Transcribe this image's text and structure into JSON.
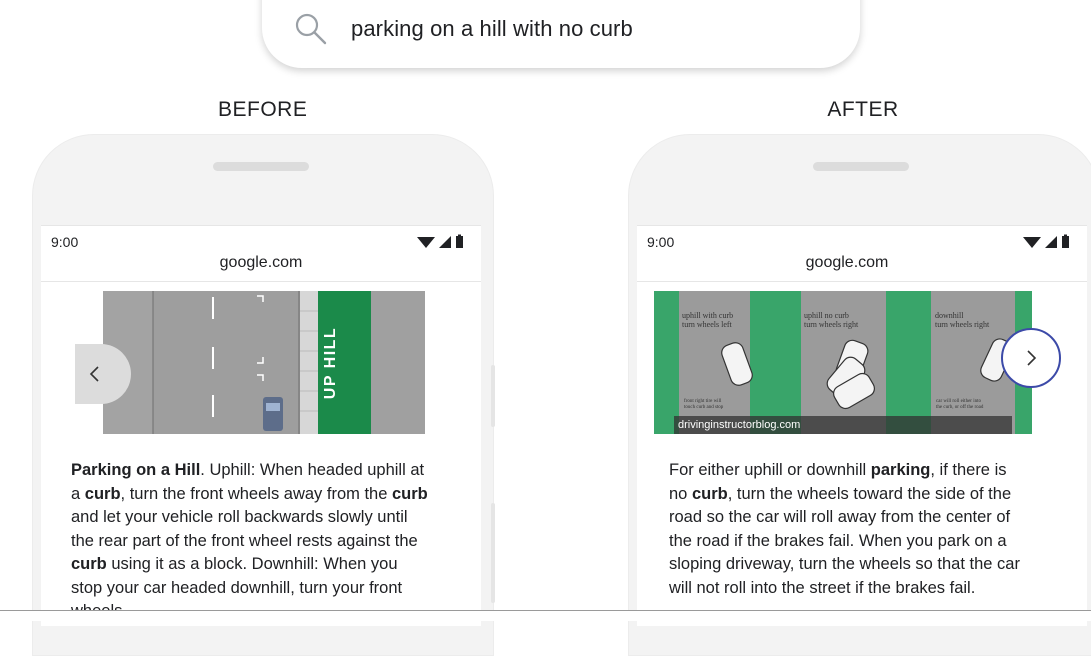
{
  "search": {
    "query": "parking on a hill with no curb",
    "icon": "search-icon"
  },
  "before": {
    "label": "BEFORE",
    "time": "9:00",
    "url": "google.com",
    "image_text": "UP HILL",
    "snippet": [
      {
        "t": "Parking on a Hill",
        "b": true
      },
      {
        "t": ". Uphill: When headed uphill at a ",
        "b": false
      },
      {
        "t": "curb",
        "b": true
      },
      {
        "t": ", turn the front wheels away from the ",
        "b": false
      },
      {
        "t": "curb",
        "b": true
      },
      {
        "t": " and let your vehicle roll backwards slowly until the rear part of the front wheel rests against the ",
        "b": false
      },
      {
        "t": "curb",
        "b": true
      },
      {
        "t": " using it as a block. Downhill: When you stop your car headed downhill, turn your front wheels",
        "b": false
      }
    ]
  },
  "after": {
    "label": "AFTER",
    "time": "9:00",
    "url": "google.com",
    "image_credit": "drivinginstructorblog.com",
    "panels": [
      {
        "title": "uphill with curb\nturn wheels left",
        "note": "front right tire will\ntouch curb and stop"
      },
      {
        "title": "uphill no curb\nturn wheels right",
        "note": ""
      },
      {
        "title": "downhill\nturn wheels right",
        "note": "car will roll either into\nthe curb, or off the road"
      }
    ],
    "snippet": [
      {
        "t": "For either uphill or downhill ",
        "b": false
      },
      {
        "t": "parking",
        "b": true
      },
      {
        "t": ", if there is no ",
        "b": false
      },
      {
        "t": "curb",
        "b": true
      },
      {
        "t": ", turn the wheels toward the side of the road so the car will roll away from the center of the road if the brakes fail. When you park on a sloping driveway, turn the wheels so that the car will not roll into the street if the brakes fail.",
        "b": false
      }
    ]
  },
  "colors": {
    "green": "#1b8a4a",
    "panel_green": "#39a56a",
    "road": "#9e9e9e",
    "nav_ring": "#3c4aa8"
  }
}
